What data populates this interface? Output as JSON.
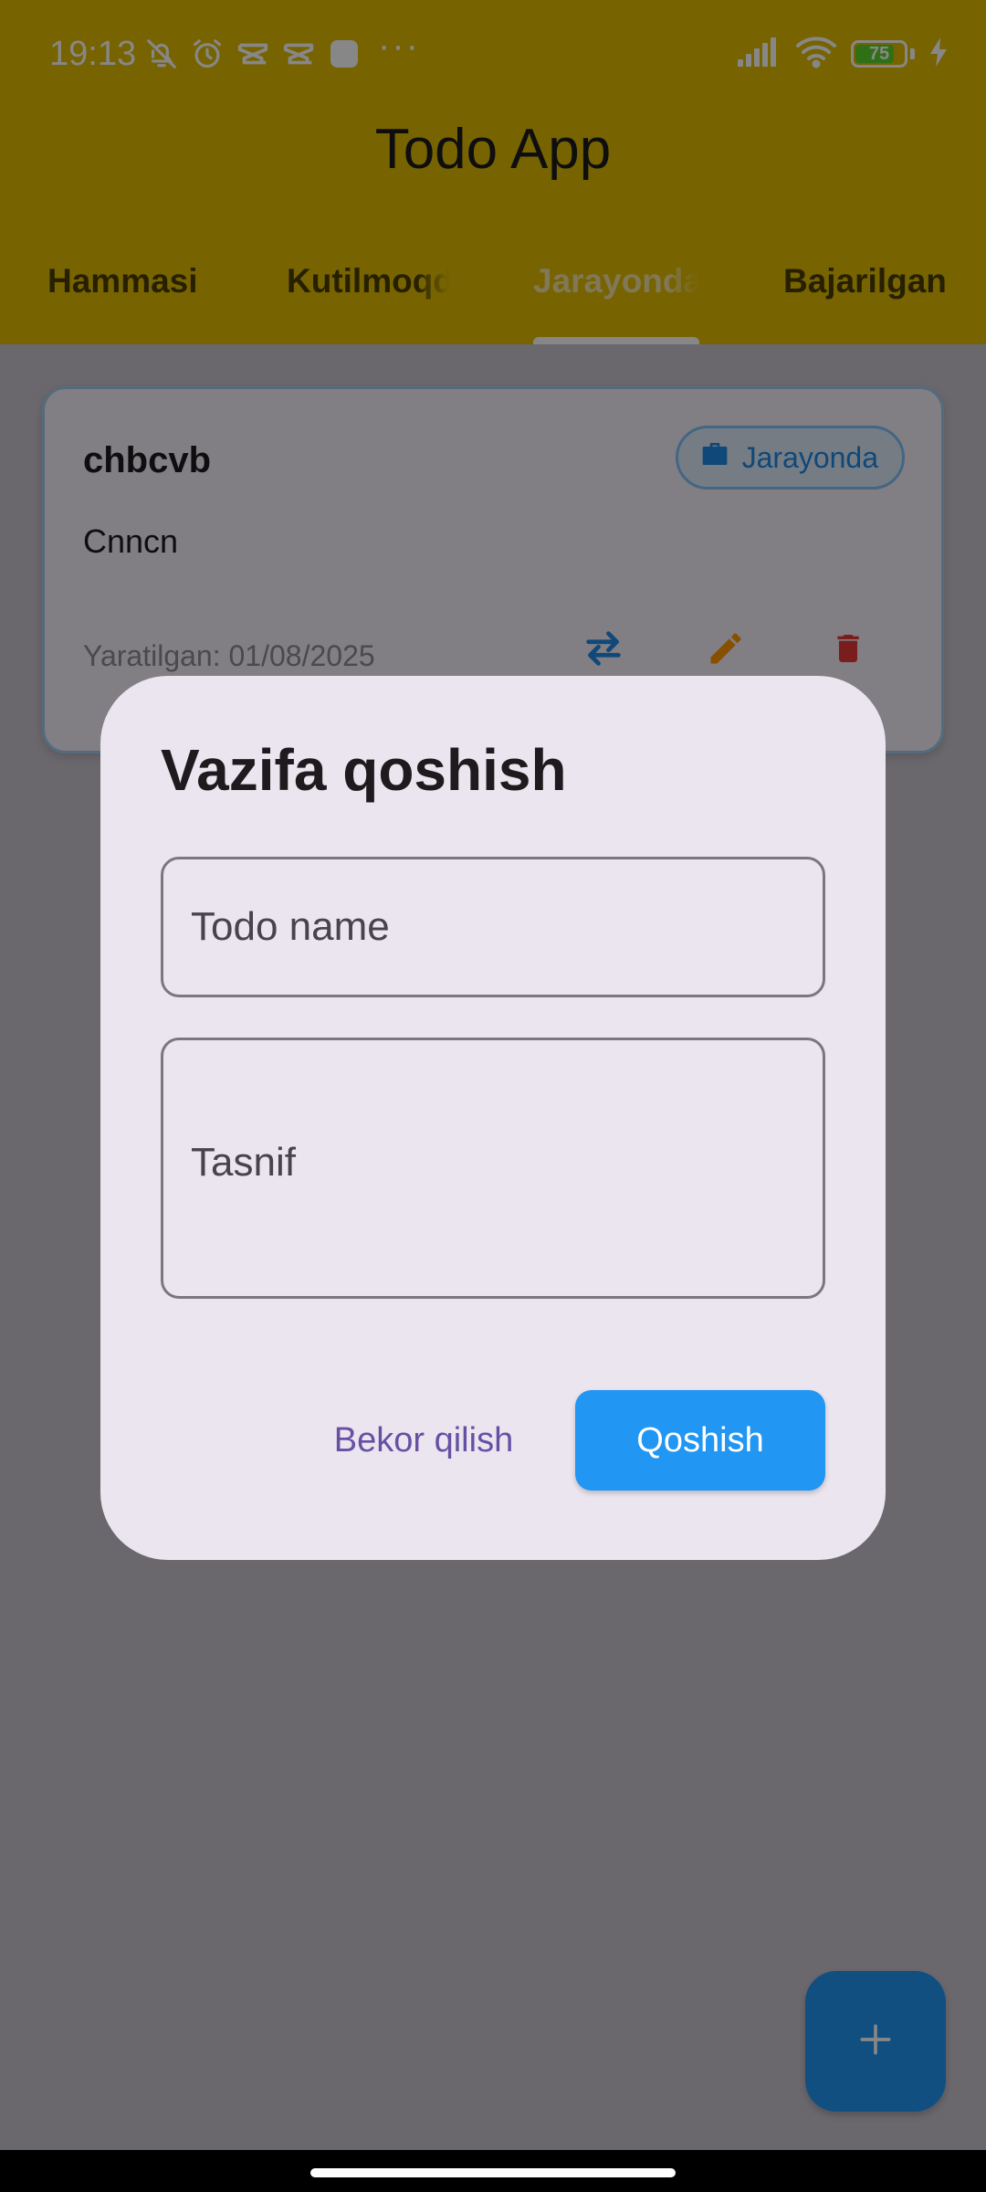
{
  "status_bar": {
    "time": "19:13",
    "more_dots": "···",
    "battery_level": "75",
    "battery_fraction": 0.75,
    "icons_left": [
      "bell-off-icon",
      "alarm-icon",
      "capcut-icon",
      "capcut-icon",
      "app-square-icon"
    ],
    "icons_right": [
      "signal-icon",
      "wifi-icon",
      "battery-icon",
      "charging-icon"
    ]
  },
  "app_bar": {
    "title": "Todo App",
    "background_color": "#e1bc00"
  },
  "tabs": [
    {
      "label": "Hammasi",
      "active": false
    },
    {
      "label": "Kutilmoqda",
      "active": false
    },
    {
      "label": "Jarayonda",
      "active": true
    },
    {
      "label": "Bajarilgan",
      "active": false
    }
  ],
  "task_card": {
    "title": "chbcvb",
    "description": "Cnncn",
    "status": "Jarayonda",
    "status_icon": "briefcase-icon",
    "created": "Yaratilgan: 01/08/2025",
    "actions": [
      "swap-icon",
      "edit-icon",
      "delete-icon"
    ]
  },
  "fab": {
    "icon": "plus-icon"
  },
  "dialog": {
    "title": "Vazifa qoshish",
    "name_placeholder": "Todo name",
    "name_value": "",
    "description_placeholder": "Tasnif",
    "description_value": "",
    "cancel_label": "Bekor qilish",
    "submit_label": "Qoshish",
    "accent_color": "#2196f3"
  }
}
